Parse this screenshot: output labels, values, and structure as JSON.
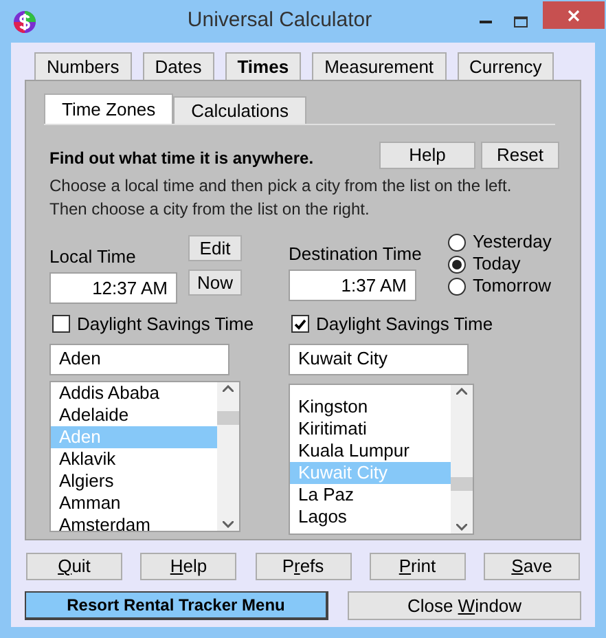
{
  "window": {
    "title": "Universal Calculator"
  },
  "tabs": [
    {
      "label": "Numbers",
      "selected": false
    },
    {
      "label": "Dates",
      "selected": false
    },
    {
      "label": "Times",
      "selected": true
    },
    {
      "label": "Measurement",
      "selected": false
    },
    {
      "label": "Currency",
      "selected": false
    }
  ],
  "subtabs": [
    {
      "label": "Time Zones",
      "selected": true
    },
    {
      "label": "Calculations",
      "selected": false
    }
  ],
  "heading": "Find out what time it is anywhere.",
  "header_buttons": [
    "Help",
    "Reset"
  ],
  "instructions": [
    "Choose a local time and then pick a city from the list on the left.",
    "Then choose a city from the list on the right."
  ],
  "local": {
    "label": "Local Time",
    "time": "12:37 AM",
    "edit_button": "Edit",
    "now_button": "Now",
    "dst": {
      "label": "Daylight Savings Time",
      "checked": false
    },
    "city": "Aden",
    "cities": [
      {
        "name": "Addis Ababa",
        "selected": false
      },
      {
        "name": "Adelaide",
        "selected": false
      },
      {
        "name": "Aden",
        "selected": true
      },
      {
        "name": "Aklavik",
        "selected": false
      },
      {
        "name": "Algiers",
        "selected": false
      },
      {
        "name": "Amman",
        "selected": false
      },
      {
        "name": "Amsterdam",
        "selected": false
      }
    ]
  },
  "destination": {
    "label": "Destination Time",
    "time": "1:37 AM",
    "dst": {
      "label": "Daylight Savings Time",
      "checked": true
    },
    "city": "Kuwait City",
    "cities": [
      {
        "name": "Kingston",
        "selected": false
      },
      {
        "name": "Kiritimati",
        "selected": false
      },
      {
        "name": "Kuala Lumpur",
        "selected": false
      },
      {
        "name": "Kuwait City",
        "selected": true
      },
      {
        "name": "La Paz",
        "selected": false
      },
      {
        "name": "Lagos",
        "selected": false
      }
    ]
  },
  "day_options": [
    {
      "label": "Yesterday",
      "selected": false
    },
    {
      "label": "Today",
      "selected": true
    },
    {
      "label": "Tomorrow",
      "selected": false
    }
  ],
  "bottom_buttons": [
    {
      "mnemonic": "Q",
      "after": "uit"
    },
    {
      "mnemonic": "H",
      "after": "elp"
    },
    {
      "before": "P",
      "mnemonic": "r",
      "after": "efs"
    },
    {
      "mnemonic": "P",
      "after": "rint"
    },
    {
      "mnemonic": "S",
      "after": "ave"
    }
  ],
  "menu_button": "Resort Rental Tracker Menu",
  "close_button": {
    "before": "Close ",
    "mnemonic": "W",
    "after": "indow"
  }
}
